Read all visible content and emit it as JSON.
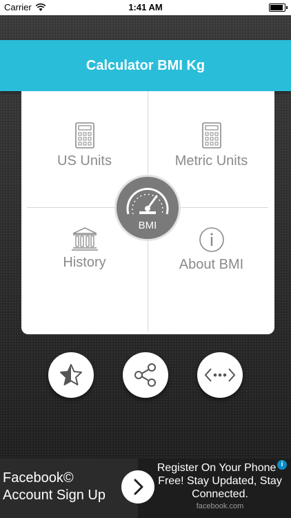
{
  "status_bar": {
    "carrier": "Carrier",
    "time": "1:41 AM",
    "battery_level": 1.0
  },
  "header": {
    "title": "Calculator BMI Kg"
  },
  "menu": {
    "us_units": "US Units",
    "metric_units": "Metric Units",
    "history": "History",
    "about_bmi": "About BMI",
    "center_badge": "BMI"
  },
  "actions": {
    "rate_icon": "star-half-icon",
    "share_icon": "share-icon",
    "more_icon": "code-more-icon"
  },
  "ad": {
    "title": "Facebook© Account Sign Up",
    "description": "Register On Your Phone - Free! Stay Updated, Stay Connected.",
    "source": "facebook.com",
    "choices_glyph": "i"
  },
  "colors": {
    "accent": "#29bdd9",
    "icon_gray": "#8a8a8a",
    "badge": "#7a7a7a"
  }
}
